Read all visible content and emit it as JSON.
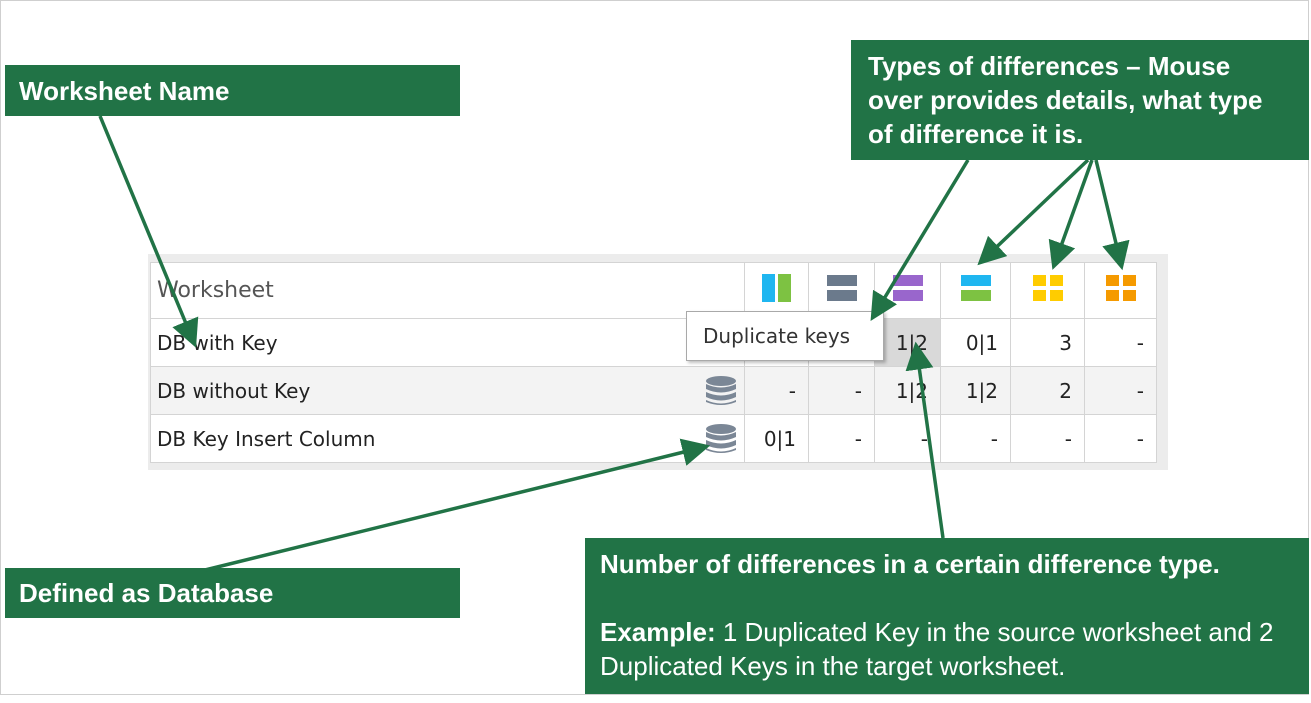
{
  "callouts": {
    "worksheet_name": "Worksheet Name",
    "defined_as_database": "Defined as Database",
    "types_of_differences": "Types of differences – Mouse over provides details, what type of difference it is.",
    "number_title": "Number of differences in a certain difference type.",
    "example_label": "Example:",
    "example_text": " 1 Duplicated Key in the source worksheet and 2 Duplicated Keys in the target worksheet."
  },
  "table": {
    "header_label": "Worksheet",
    "column_icons": [
      {
        "name": "column-diff-icon",
        "colors": [
          "#1fb6f0",
          "#7dc242"
        ]
      },
      {
        "name": "row-diff-icon",
        "colors": [
          "#6b7a8c",
          "#6b7a8c"
        ]
      },
      {
        "name": "duplicate-keys-icon",
        "colors": [
          "#9966cc",
          "#9966cc"
        ]
      },
      {
        "name": "row-insert-icon",
        "colors": [
          "#1fb6f0",
          "#7dc242"
        ]
      },
      {
        "name": "cell-diff-yellow-icon",
        "colors": [
          "#ffcc00"
        ]
      },
      {
        "name": "cell-diff-orange-icon",
        "colors": [
          "#f59a00"
        ]
      }
    ],
    "rows": [
      {
        "name": "DB with Key",
        "database": false,
        "values": [
          "",
          "",
          "1|2",
          "0|1",
          "3",
          "-"
        ]
      },
      {
        "name": "DB without Key",
        "database": true,
        "values": [
          "-",
          "-",
          "1|2",
          "1|2",
          "2",
          "-"
        ]
      },
      {
        "name": "DB Key Insert Column",
        "database": true,
        "values": [
          "0|1",
          "-",
          "-",
          "-",
          "-",
          "-"
        ]
      }
    ]
  },
  "tooltip": "Duplicate keys",
  "colors": {
    "accent": "#217346",
    "database_icon": "#7b8796"
  }
}
